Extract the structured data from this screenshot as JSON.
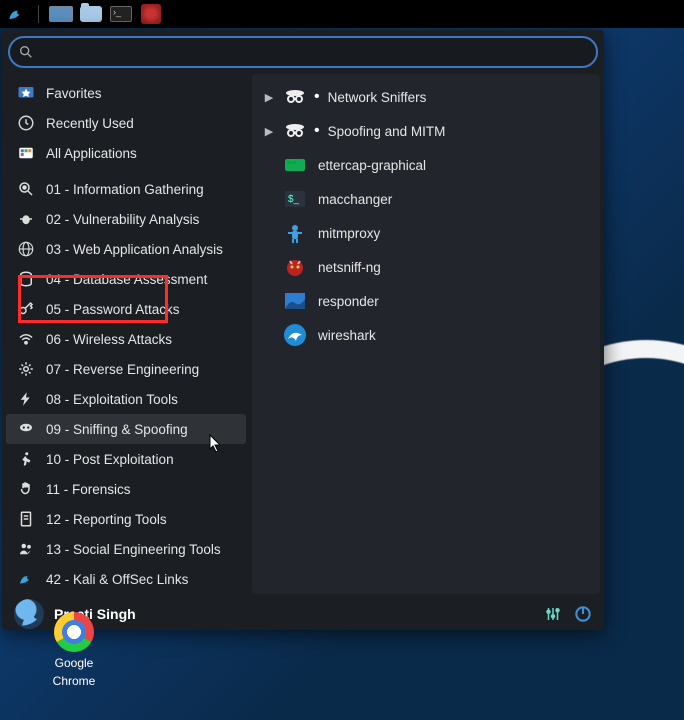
{
  "taskbar": {
    "icons": [
      "dragon-icon",
      "window-icon",
      "folder-icon",
      "terminal-icon",
      "shield-icon"
    ]
  },
  "search": {
    "placeholder": ""
  },
  "views": [
    {
      "label": "Favorites",
      "icon": "star-icon",
      "name": "view-favorites"
    },
    {
      "label": "Recently Used",
      "icon": "clock-icon",
      "name": "view-recently-used"
    },
    {
      "label": "All Applications",
      "icon": "grid-icon",
      "name": "view-all-applications"
    }
  ],
  "categories": [
    {
      "label": "01 - Information Gathering",
      "icon": "magnifier-icon",
      "name": "cat-information-gathering"
    },
    {
      "label": "02 - Vulnerability Analysis",
      "icon": "bug-icon",
      "name": "cat-vulnerability-analysis"
    },
    {
      "label": "03 - Web Application Analysis",
      "icon": "globe-icon",
      "name": "cat-web-application"
    },
    {
      "label": "04 - Database Assessment",
      "icon": "db-icon",
      "name": "cat-database"
    },
    {
      "label": "05 - Password Attacks",
      "icon": "key-icon",
      "name": "cat-password"
    },
    {
      "label": "06 - Wireless Attacks",
      "icon": "wifi-icon",
      "name": "cat-wireless"
    },
    {
      "label": "07 - Reverse Engineering",
      "icon": "gear-icon",
      "name": "cat-reverse"
    },
    {
      "label": "08 - Exploitation Tools",
      "icon": "bolt-icon",
      "name": "cat-exploitation"
    },
    {
      "label": "09 - Sniffing & Spoofing",
      "icon": "mask-icon",
      "name": "cat-sniffing",
      "selected": true
    },
    {
      "label": "10 - Post Exploitation",
      "icon": "run-icon",
      "name": "cat-post-exploitation"
    },
    {
      "label": "11 - Forensics",
      "icon": "hand-icon",
      "name": "cat-forensics"
    },
    {
      "label": "12 - Reporting Tools",
      "icon": "doc-icon",
      "name": "cat-reporting"
    },
    {
      "label": "13 - Social Engineering Tools",
      "icon": "people-icon",
      "name": "cat-social"
    },
    {
      "label": "42 - Kali & OffSec Links",
      "icon": "link-icon",
      "name": "cat-links"
    }
  ],
  "subcategories": [
    {
      "label": "Network Sniffers",
      "icon": "spy-icon",
      "name": "sub-network-sniffers"
    },
    {
      "label": "Spoofing and MITM",
      "icon": "spy-icon",
      "name": "sub-spoofing-mitm"
    }
  ],
  "apps": [
    {
      "label": "ettercap-graphical",
      "icon": "ettercap-icon",
      "name": "app-ettercap"
    },
    {
      "label": "macchanger",
      "icon": "terminal-app-icon",
      "name": "app-macchanger"
    },
    {
      "label": "mitmproxy",
      "icon": "person-icon",
      "name": "app-mitmproxy"
    },
    {
      "label": "netsniff-ng",
      "icon": "devil-icon",
      "name": "app-netsniff"
    },
    {
      "label": "responder",
      "icon": "wave-icon",
      "name": "app-responder"
    },
    {
      "label": "wireshark",
      "icon": "shark-icon",
      "name": "app-wireshark",
      "highlighted": true
    }
  ],
  "user": {
    "name": "Preeti Singh"
  },
  "footer": {
    "settings_icon": "sliders-icon",
    "power_icon": "power-icon"
  },
  "desktop": {
    "chrome_label_1": "Google",
    "chrome_label_2": "Chrome"
  },
  "colors": {
    "accent": "#3d7ac6",
    "highlight": "#ff2a2a",
    "panel_bg": "#1b1f24",
    "right_bg": "#22262c"
  }
}
